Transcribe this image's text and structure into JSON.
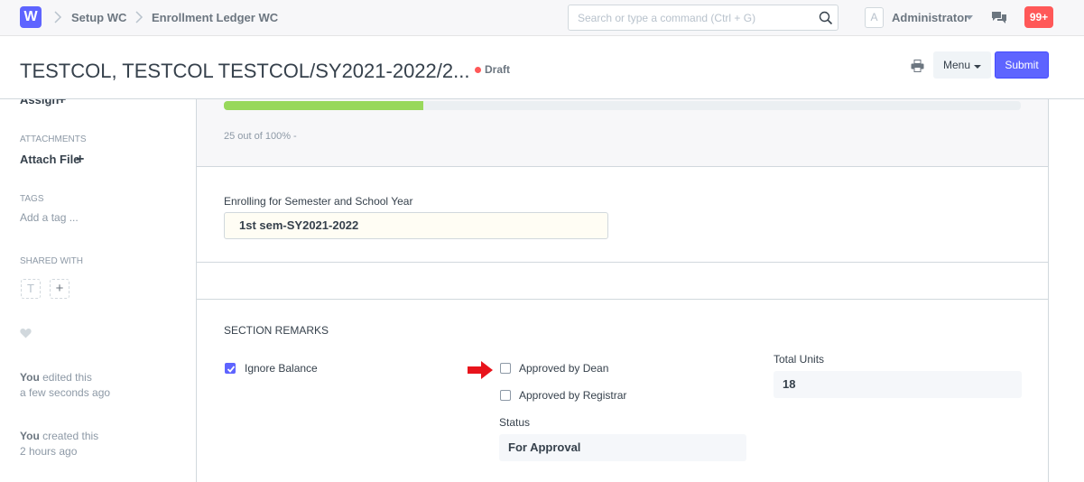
{
  "navbar": {
    "logo_letter": "W",
    "breadcrumbs": [
      "Setup WC",
      "Enrollment Ledger WC"
    ],
    "search_placeholder": "Search or type a command (Ctrl + G)",
    "avatar_letter": "A",
    "user_name": "Administrator",
    "notification_count": "99+"
  },
  "page_head": {
    "title": "TESTCOL, TESTCOL TESTCOL/SY2021-2022/2...",
    "status": "Draft",
    "menu_label": "Menu",
    "submit_label": "Submit"
  },
  "sidebar": {
    "assign_label": "Assign",
    "attachments_heading": "Attachments",
    "attach_file_label": "Attach File",
    "tags_heading": "Tags",
    "add_tag_label": "Add a tag ...",
    "shared_with_heading": "Shared With",
    "shared_avatar_letter": "T",
    "activity": [
      {
        "actor": "You",
        "action": "edited this",
        "time": "a few seconds ago"
      },
      {
        "actor": "You",
        "action": "created this",
        "time": "2 hours ago"
      }
    ]
  },
  "progress": {
    "fraction": 0.25,
    "text": "25 out of 100% -"
  },
  "enrollment": {
    "semester_label": "Enrolling for Semester and School Year",
    "semester_value": "1st sem-SY2021-2022"
  },
  "remarks": {
    "heading": "Section Remarks",
    "ignore_balance_label": "Ignore Balance",
    "ignore_balance_checked": true,
    "approved_by_dean_label": "Approved by Dean",
    "approved_by_dean_checked": false,
    "approved_by_registrar_label": "Approved by Registrar",
    "approved_by_registrar_checked": false,
    "status_label": "Status",
    "status_value": "For Approval",
    "total_units_label": "Total Units",
    "total_units_value": "18"
  },
  "colors": {
    "brand": "#5e64ff",
    "progress": "#98d85b",
    "draft_indicator": "#ff5858",
    "annotation_arrow": "#e8141c"
  }
}
